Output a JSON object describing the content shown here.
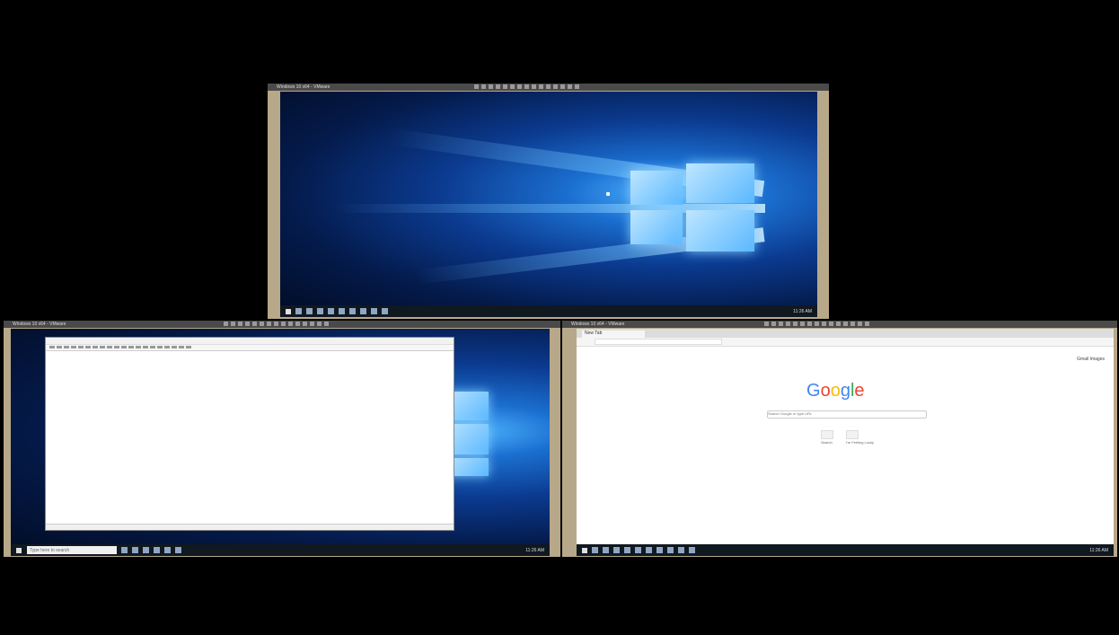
{
  "top_vm": {
    "title": "Windows 10 x64 - VMware",
    "clock": "11:26 AM"
  },
  "left_vm": {
    "title": "Windows 10 x64 - VMware",
    "taskbar_search": "Type here to search",
    "clock": "11:26 AM"
  },
  "right_vm": {
    "title": "Windows 10 x64 - VMware",
    "clock": "11:26 AM",
    "browser": {
      "tab_label": "New Tab",
      "url": "",
      "top_links": "Gmail  Images",
      "logo": {
        "G": "G",
        "o1": "o",
        "o2": "o",
        "g": "g",
        "l": "l",
        "e": "e"
      },
      "search_placeholder": "Search Google or type URL",
      "btn1": "Search",
      "btn2": "I'm Feeling Lucky"
    }
  }
}
